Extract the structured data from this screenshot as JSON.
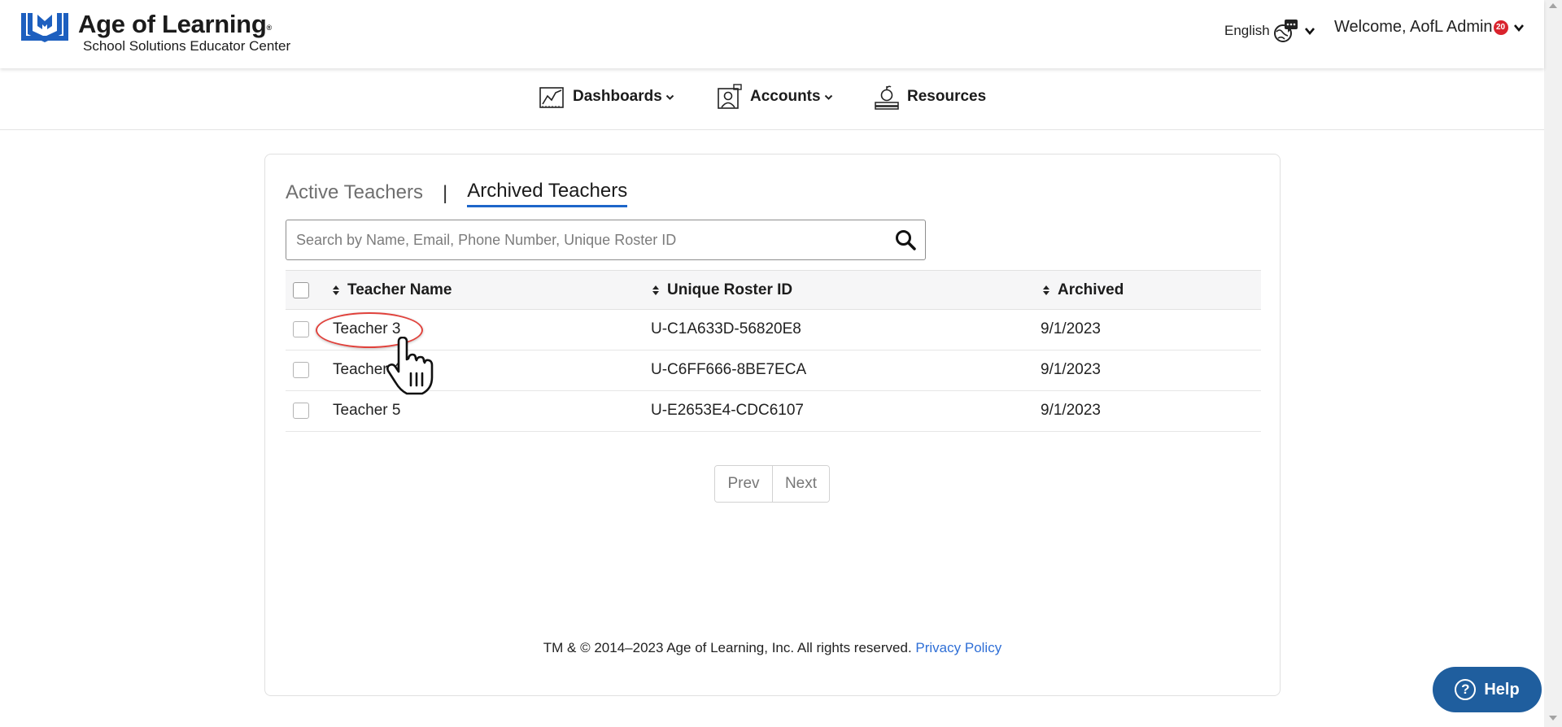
{
  "brand": {
    "title": "Age of Learning",
    "trademark": "®",
    "subtitle": "School Solutions Educator Center",
    "accent_color": "#1d5fbf"
  },
  "header": {
    "language": {
      "label": "English",
      "icon": "globe-chat-icon"
    },
    "welcome": {
      "label": "Welcome, AofL Admin",
      "badge_count": "20",
      "badge_color": "#d9232d"
    }
  },
  "nav": {
    "items": [
      {
        "label": "Dashboards",
        "icon": "chart-icon",
        "has_dropdown": true
      },
      {
        "label": "Accounts",
        "icon": "user-profile-icon",
        "has_dropdown": true
      },
      {
        "label": "Resources",
        "icon": "apple-books-icon",
        "has_dropdown": false
      }
    ]
  },
  "tabs": {
    "active_teachers": "Active Teachers",
    "separator": "|",
    "archived_teachers": "Archived Teachers",
    "selected": "Archived Teachers"
  },
  "search": {
    "placeholder": "Search by Name, Email, Phone Number, Unique Roster ID",
    "value": ""
  },
  "table": {
    "columns": [
      "Teacher Name",
      "Unique Roster ID",
      "Archived"
    ],
    "rows": [
      {
        "name": "Teacher 3",
        "roster_id": "U-C1A633D-56820E8",
        "archived": "9/1/2023"
      },
      {
        "name": "Teacher 4",
        "roster_id": "U-C6FF666-8BE7ECA",
        "archived": "9/1/2023"
      },
      {
        "name": "Teacher 5",
        "roster_id": "U-E2653E4-CDC6107",
        "archived": "9/1/2023"
      }
    ]
  },
  "pagination": {
    "prev": "Prev",
    "next": "Next"
  },
  "footer": {
    "copyright": "TM & © 2014–2023 Age of Learning, Inc. All rights reserved.",
    "privacy_link": "Privacy Policy"
  },
  "help": {
    "label": "Help"
  }
}
